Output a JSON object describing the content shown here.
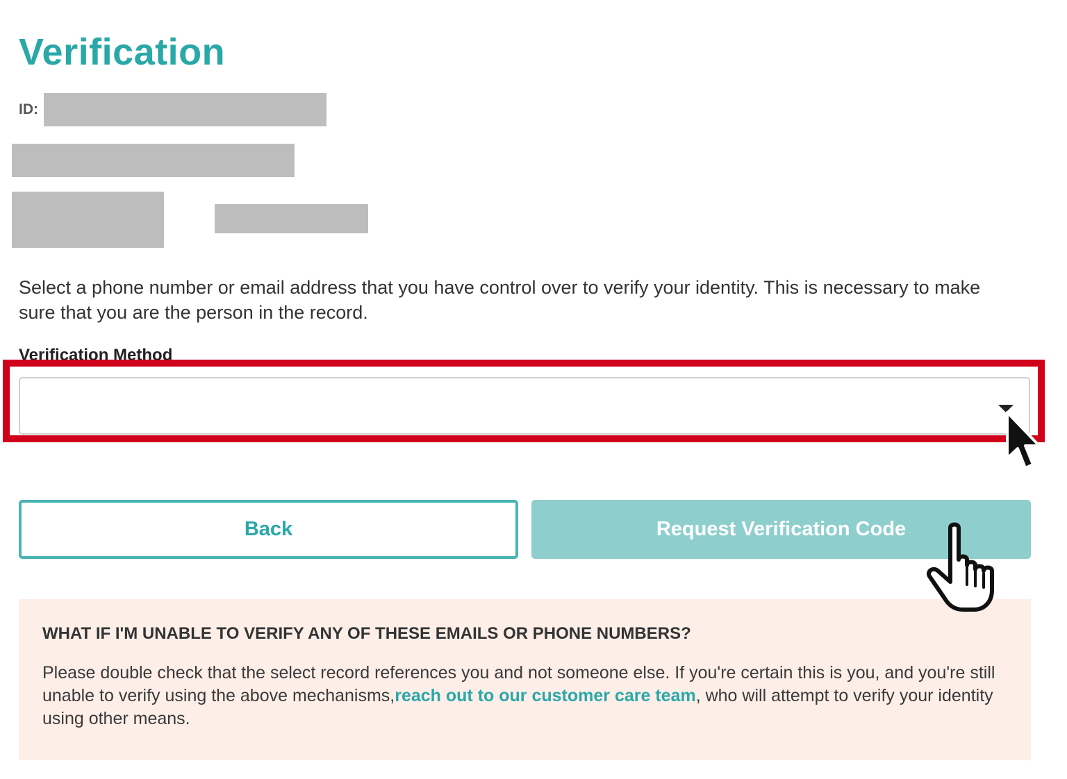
{
  "page": {
    "title": "Verification",
    "id_label": "ID:"
  },
  "instructions": "Select a phone number or email address that you have control over to verify your identity. This is necessary to make sure that you are the person in the record.",
  "verification_method": {
    "label": "Verification Method",
    "selected_value": "",
    "dropdown_icon": "caret-down-icon"
  },
  "buttons": {
    "back": "Back",
    "request_code": "Request Verification Code"
  },
  "help": {
    "title": "WHAT IF I'M UNABLE TO VERIFY ANY OF THESE EMAILS OR PHONE NUMBERS?",
    "body_before_link": "Please double check that the select record references you and not someone else. If you're certain this is you, and you're still unable to verify using the above mechanisms,",
    "link_text": "reach out to our customer care team",
    "body_after_link": ", who will attempt to verify your identity using other means."
  },
  "colors": {
    "accent": "#2aa8a8",
    "button_disabled_bg": "#8ecfcd",
    "highlight": "#d0021b",
    "help_bg": "#fdeee8",
    "redaction": "#bdbdbd"
  },
  "annotations": {
    "highlight_target": "verification-method-select",
    "cursors": [
      "arrow-cursor-icon",
      "hand-pointer-icon"
    ]
  }
}
